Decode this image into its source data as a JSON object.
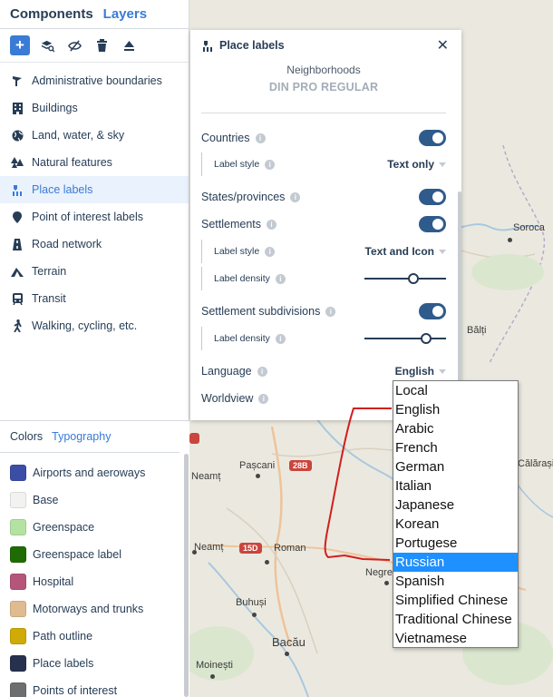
{
  "sidebar": {
    "tabs": [
      {
        "label": "Components",
        "active": true
      },
      {
        "label": "Layers",
        "active": false
      }
    ],
    "components": [
      {
        "label": "Administrative boundaries",
        "icon": "flag-icon",
        "selected": false
      },
      {
        "label": "Buildings",
        "icon": "building-icon",
        "selected": false
      },
      {
        "label": "Land, water, & sky",
        "icon": "globe-icon",
        "selected": false
      },
      {
        "label": "Natural features",
        "icon": "trees-icon",
        "selected": false
      },
      {
        "label": "Place labels",
        "icon": "place-labels-icon",
        "selected": true
      },
      {
        "label": "Point of interest labels",
        "icon": "pin-icon",
        "selected": false
      },
      {
        "label": "Road network",
        "icon": "road-icon",
        "selected": false
      },
      {
        "label": "Terrain",
        "icon": "mountain-icon",
        "selected": false
      },
      {
        "label": "Transit",
        "icon": "train-icon",
        "selected": false
      },
      {
        "label": "Walking, cycling, etc.",
        "icon": "walking-icon",
        "selected": false
      }
    ],
    "bottom_tabs": [
      {
        "label": "Colors",
        "active": true
      },
      {
        "label": "Typography",
        "active": false
      }
    ],
    "colors": [
      {
        "label": "Airports and aeroways",
        "color": "#3b4ea6"
      },
      {
        "label": "Base",
        "color": "#f2f2f1"
      },
      {
        "label": "Greenspace",
        "color": "#b4e2a2"
      },
      {
        "label": "Greenspace label",
        "color": "#1f6b04"
      },
      {
        "label": "Hospital",
        "color": "#b5557a"
      },
      {
        "label": "Motorways and trunks",
        "color": "#dfbb8f"
      },
      {
        "label": "Path outline",
        "color": "#d0aa05"
      },
      {
        "label": "Place labels",
        "color": "#26314d"
      },
      {
        "label": "Points of interest",
        "color": "#6d6e6f"
      }
    ]
  },
  "panel": {
    "title": "Place labels",
    "font_subtitle": "Neighborhoods",
    "font_name": "DIN PRO REGULAR",
    "countries": "Countries",
    "label_style": "Label style",
    "countries_style_value": "Text only",
    "states": "States/provinces",
    "settlements": "Settlements",
    "settlements_style_value": "Text and Icon",
    "label_density": "Label density",
    "settlements_density": 0.6,
    "subdivisions": "Settlement subdivisions",
    "subdivisions_density": 0.75,
    "language": "Language",
    "language_value": "English",
    "worldview": "Worldview"
  },
  "language_options": [
    "Local",
    "English",
    "Arabic",
    "French",
    "German",
    "Italian",
    "Japanese",
    "Korean",
    "Portugese",
    "Russian",
    "Spanish",
    "Simplified Chinese",
    "Traditional Chinese",
    "Vietnamese"
  ],
  "language_highlighted": "Russian",
  "map": {
    "places": [
      "Soroca",
      "Bălți",
      "Călărași",
      "Neamț",
      "Pașcani",
      "Neamț",
      "Roman",
      "Negre",
      "Buhuși",
      "Bacău",
      "Moinești"
    ],
    "shields": [
      "28B",
      "15D"
    ]
  },
  "colors": {
    "accent": "#3a7bd5",
    "text": "#273d56",
    "toggle": "#2f5b8c",
    "highlight": "#1e90ff",
    "annotation": "#d11f1f"
  }
}
